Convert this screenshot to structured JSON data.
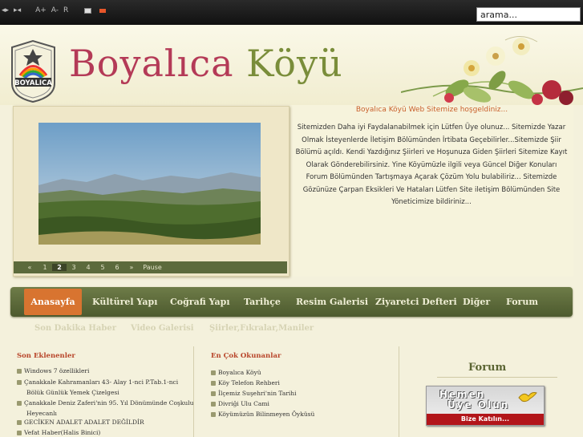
{
  "search": {
    "value": "arama..."
  },
  "topbar": {
    "font_plus": "A+",
    "font_minus": "A-",
    "font_reset": "R"
  },
  "header": {
    "title_part1": "Boyalıca",
    "title_part2": "Köyü",
    "logo_text": "BOYALICA"
  },
  "slideshow": {
    "pages": [
      "«",
      "1",
      "2",
      "3",
      "4",
      "5",
      "6",
      "»",
      "Pause"
    ],
    "active_page": "2"
  },
  "welcome": {
    "title": "Boyalıca Köyü Web Sitemize hoşgeldiniz...",
    "body": "Sitemizden Daha iyi Faydalanabilmek için Lütfen Üye olunuz... Sitemizde Yazar Olmak İsteyenlerde İletişim Bölümünden İrtibata Geçebilirler...Sitemizde Şiir Bölümü açıldı. Kendi Yazdığınız Şiirleri ve Hoşunuza Giden Şiirleri Sitemize Kayıt Olarak Gönderebilirsiniz. Yine Köyümüzle ilgili veya Güncel Diğer Konuları Forum Bölümünden Tartışmaya Açarak Çözüm Yolu bulabiliriz... Sitemizde Gözünüze Çarpan Eksikleri Ve Hataları Lütfen Site iletişim Bölümünden Site Yöneticimize bildiriniz..."
  },
  "nav": {
    "items": [
      "Anasayfa",
      "Kültürel Yapı",
      "Coğrafi Yapı",
      "Tarihçe",
      "Resim Galerisi",
      "Ziyaretci Defteri",
      "Diğer",
      "Forum"
    ]
  },
  "subnav": {
    "items": [
      "Son Dakika Haber",
      "Video Galerisi",
      "Şiirler,Fıkralar,Maniler"
    ]
  },
  "latest": {
    "heading": "Son Eklenenler",
    "items": [
      "Windows 7 özellikleri",
      "Çanakkale Kahramanları 43- Alay 1-nci P.Tab.1-nci",
      "Bölük Günlük Yemek Çizelgesi",
      "Çanakkale Deniz Zaferi'nin 95. Yıl Dönümünde Coşkulu",
      "Heyecanlı",
      "GECİKEN ADALET ADALET DEĞİLDİR",
      "Vefat Haber(Halis Binici)"
    ]
  },
  "popular": {
    "heading": "En Çok Okunanlar",
    "items": [
      "Boyalıca Köyü",
      "Köy Telefon Rehberi",
      "İlçemiz Suşehri'nin Tarihi",
      "Divriği Ulu Cami",
      "Köyümüzün Bilinmeyen Öyküsü"
    ]
  },
  "forum": {
    "heading": "Forum",
    "banner_line1": "Hemen",
    "banner_line2": "Üye Olun",
    "banner_sub": "Bize Katılın..."
  }
}
